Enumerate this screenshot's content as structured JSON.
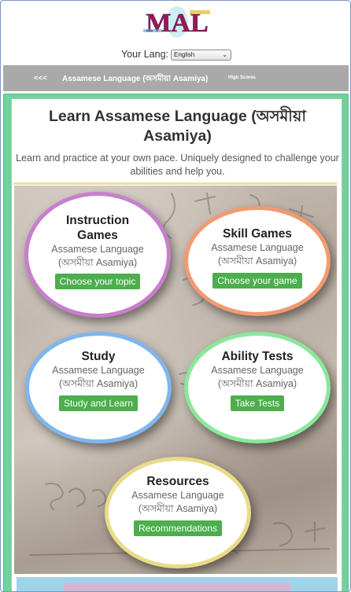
{
  "header": {
    "logo_text": "MAL",
    "lang_label": "Your Lang:",
    "lang_selected": "English"
  },
  "nav": {
    "back": "<<<",
    "title": "Assamese Language (অসমীয়া Asamiya)",
    "high_scores": "High Scores"
  },
  "page": {
    "title": "Learn Assamese Language (অসমীয়া Asamiya)",
    "subtitle": "Learn and practice at your own pace. Uniquely designed to challenge your abilities and help you."
  },
  "cards": [
    {
      "title": "Instruction Games",
      "lang_line1": "Assamese Language",
      "lang_line2": "(অসমীয়া Asamiya)",
      "button": "Choose your topic",
      "border_color": "#c77fcc"
    },
    {
      "title": "Skill Games",
      "lang_line1": "Assamese Language",
      "lang_line2": "(অসমীয়া Asamiya)",
      "button": "Choose your game",
      "border_color": "#f29a72"
    },
    {
      "title": "Study",
      "lang_line1": "Assamese Language",
      "lang_line2": "(অসমীয়া Asamiya)",
      "button": "Study and Learn",
      "border_color": "#7fb6ee"
    },
    {
      "title": "Ability Tests",
      "lang_line1": "Assamese Language",
      "lang_line2": "(অসমীয়া Asamiya)",
      "button": "Take Tests",
      "border_color": "#8ae89a"
    },
    {
      "title": "Resources",
      "lang_line1": "Assamese Language",
      "lang_line2": "(অসমীয়া Asamiya)",
      "button": "Recommendations",
      "border_color": "#eadb88"
    }
  ],
  "colors": {
    "button_green": "#4cae4c",
    "container_green": "#6fd39d",
    "navbar_gray": "#a9a9a9"
  }
}
